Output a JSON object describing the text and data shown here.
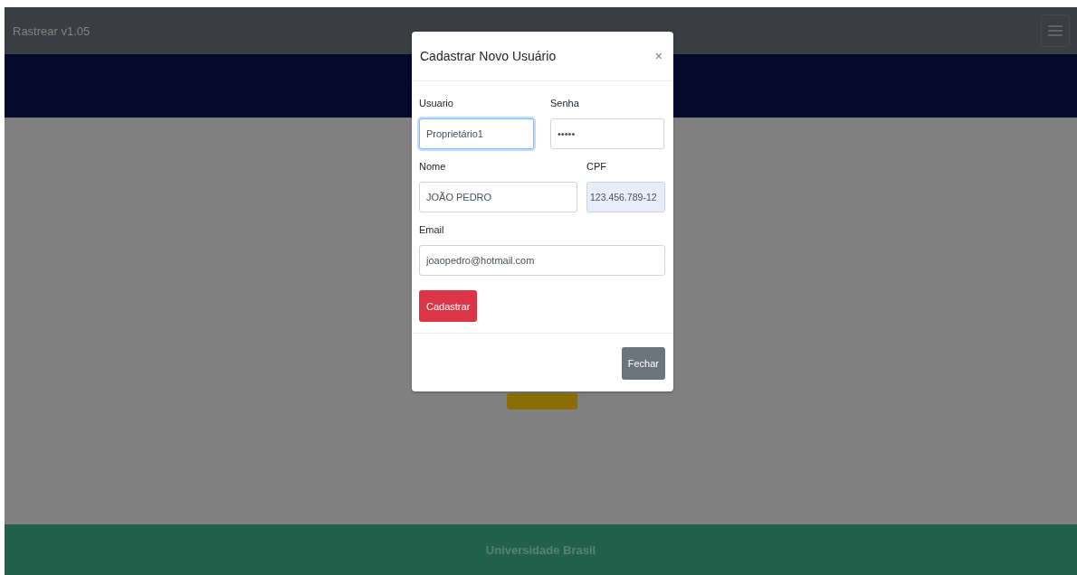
{
  "navbar": {
    "brand": "Rastrear v1.05"
  },
  "modal": {
    "title": "Cadastrar Novo Usuário",
    "close": "×",
    "fields": [
      {
        "label": "Usuario",
        "value": "Proprietário1",
        "focused": true,
        "readonly": false
      },
      {
        "label": "Senha",
        "value": "•••••",
        "focused": false,
        "readonly": false
      },
      {
        "label": "Nome",
        "value": "JOÃO PEDRO",
        "focused": false,
        "readonly": false
      },
      {
        "label": "CPF",
        "value": "123.456.789-12",
        "focused": false,
        "readonly": true
      },
      {
        "label": "Email",
        "value": "joaopedro@hotmail.com",
        "focused": false,
        "readonly": false
      }
    ],
    "submit": "Cadastrar",
    "dismiss": "Fechar"
  },
  "footer": {
    "text": "Universidade Brasil"
  }
}
